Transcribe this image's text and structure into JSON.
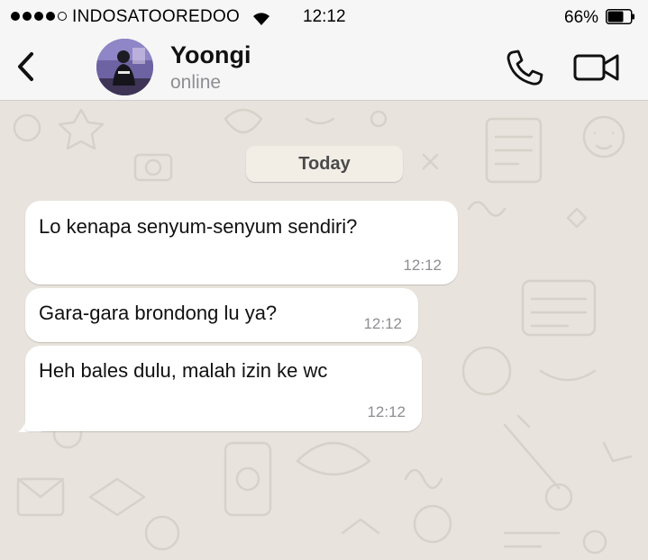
{
  "status_bar": {
    "carrier": "INDOSATOOREDOO",
    "time": "12:12",
    "battery_percent": "66%",
    "signal_bars": 4,
    "signal_max": 5,
    "wifi_icon": "wifi-icon",
    "battery_level": 0.66
  },
  "header": {
    "back_icon": "chevron-left-icon",
    "contact_name": "Yoongi",
    "contact_status": "online",
    "call_icon": "phone-icon",
    "video_icon": "video-camera-icon"
  },
  "chat": {
    "date_label": "Today",
    "messages": [
      {
        "text": "Lo kenapa senyum-senyum sendiri?",
        "time": "12:12"
      },
      {
        "text": "Gara-gara brondong lu ya?",
        "time": "12:12"
      },
      {
        "text": "Heh bales dulu, malah izin ke wc",
        "time": "12:12"
      }
    ]
  },
  "colors": {
    "wallpaper": "#e8e3dc",
    "bubble": "#ffffff",
    "header_bg": "#f6f6f6",
    "timestamp": "#8e8e93"
  }
}
